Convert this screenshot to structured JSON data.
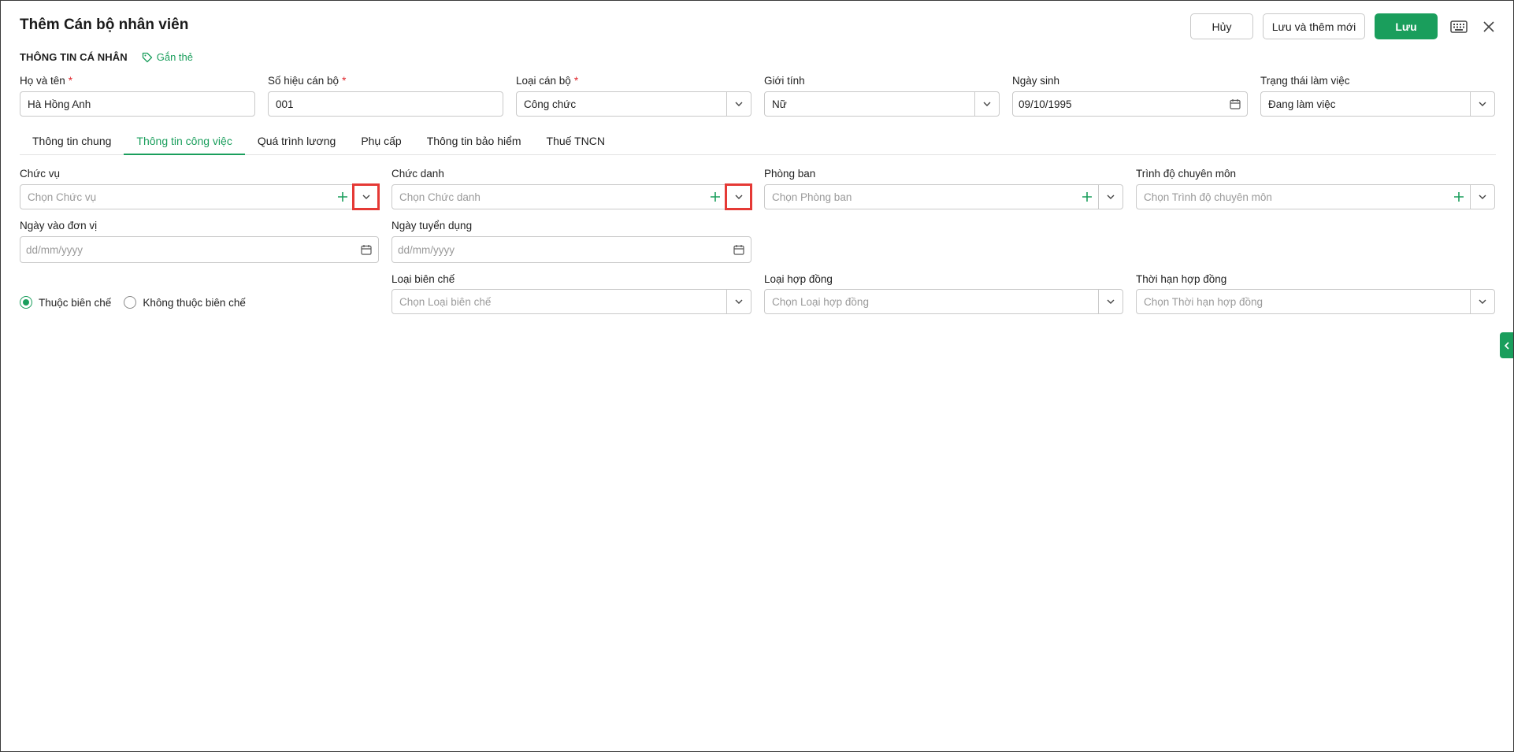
{
  "header": {
    "title": "Thêm Cán bộ nhân viên",
    "cancel_label": "Hủy",
    "save_new_label": "Lưu và thêm mới",
    "save_label": "Lưu"
  },
  "personal": {
    "section_title": "THÔNG TIN CÁ NHÂN",
    "tag_label": "Gắn thẻ",
    "full_name": {
      "label": "Họ và tên",
      "value": "Hà Hồng Anh"
    },
    "staff_code": {
      "label": "Số hiệu cán bộ",
      "value": "001"
    },
    "staff_type": {
      "label": "Loại cán bộ",
      "value": "Công chức"
    },
    "gender": {
      "label": "Giới tính",
      "value": "Nữ"
    },
    "birthday": {
      "label": "Ngày sinh",
      "value": "09/10/1995"
    },
    "work_status": {
      "label": "Trạng thái làm việc",
      "value": "Đang làm việc"
    }
  },
  "tabs": [
    "Thông tin chung",
    "Thông tin công việc",
    "Quá trình lương",
    "Phụ cấp",
    "Thông tin bảo hiểm",
    "Thuế TNCN"
  ],
  "work": {
    "position": {
      "label": "Chức vụ",
      "placeholder": "Chọn Chức vụ"
    },
    "title": {
      "label": "Chức danh",
      "placeholder": "Chọn Chức danh"
    },
    "department": {
      "label": "Phòng ban",
      "placeholder": "Chọn Phòng ban"
    },
    "qualification": {
      "label": "Trình độ chuyên môn",
      "placeholder": "Chọn Trình độ chuyên môn"
    },
    "join_date": {
      "label": "Ngày vào đơn vị",
      "placeholder": "dd/mm/yyyy"
    },
    "hire_date": {
      "label": "Ngày tuyển dụng",
      "placeholder": "dd/mm/yyyy"
    },
    "payroll_type": {
      "label": "Loại biên chế",
      "placeholder": "Chọn Loại biên chế"
    },
    "contract_type": {
      "label": "Loại hợp đồng",
      "placeholder": "Chọn Loại hợp đồng"
    },
    "contract_term": {
      "label": "Thời hạn hợp đồng",
      "placeholder": "Chọn Thời hạn hợp đồng"
    },
    "radio_in": "Thuộc biên chế",
    "radio_out": "Không thuộc biên chế"
  },
  "colors": {
    "accent": "#1a9e5c",
    "required": "#e0282e",
    "highlight": "#e53935"
  }
}
